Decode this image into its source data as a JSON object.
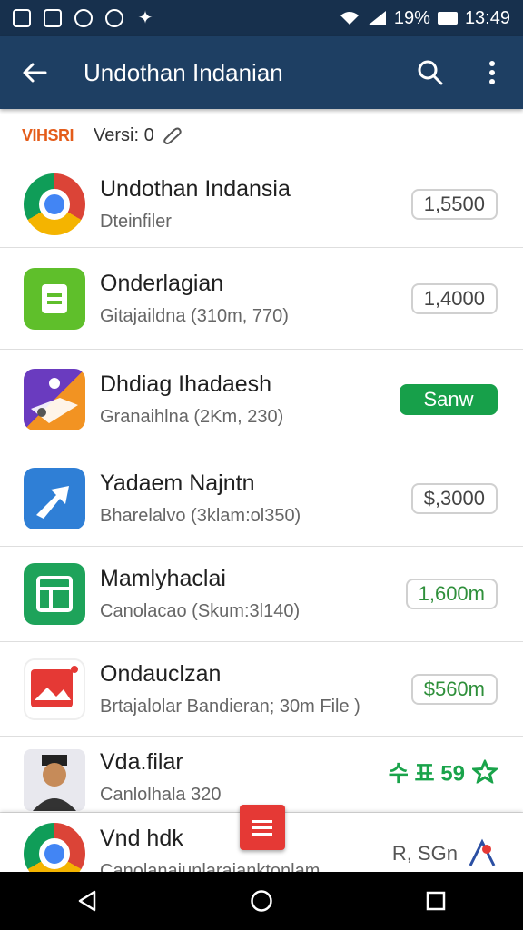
{
  "status_bar": {
    "battery": "19%",
    "time": "13:49"
  },
  "app_bar": {
    "title": "Undothan Indanian"
  },
  "version": {
    "brand": "VIHSRI",
    "label": "Versi: 0"
  },
  "items": [
    {
      "title": "Undothan Indansia",
      "subtitle": "Dteinfiler",
      "price": "1,5500"
    },
    {
      "title": "Onderlagian",
      "subtitle": "Gitajaildna (310m, 770)",
      "price": "1,4000"
    },
    {
      "title": "Dhdiag Ihadaesh",
      "subtitle": "Granaihlna (2Km, 230)",
      "price": "Sanw"
    },
    {
      "title": "Yadaem Najntn",
      "subtitle": "Bharelalvo (3klam:ol350)",
      "price": "$,3000"
    },
    {
      "title": "Mamlyhaclai",
      "subtitle": "Canolacao (Skum:3l140)",
      "price": "1,600m"
    },
    {
      "title": "Ondauclzan",
      "subtitle": "Brtajalolar Bandieran; 30m File )",
      "price": "$560m"
    },
    {
      "title": "Vda.filar",
      "subtitle": "Canlolhala 320",
      "price": "수 표 59"
    },
    {
      "title": "Vnd hdk",
      "subtitle": "Canolanajunlarajanktonlam",
      "price": "R, SGn"
    }
  ],
  "colors": {
    "status_bar": "#17304d",
    "app_bar": "#1e3f63",
    "install": "#17a04a",
    "fab": "#e53935"
  }
}
